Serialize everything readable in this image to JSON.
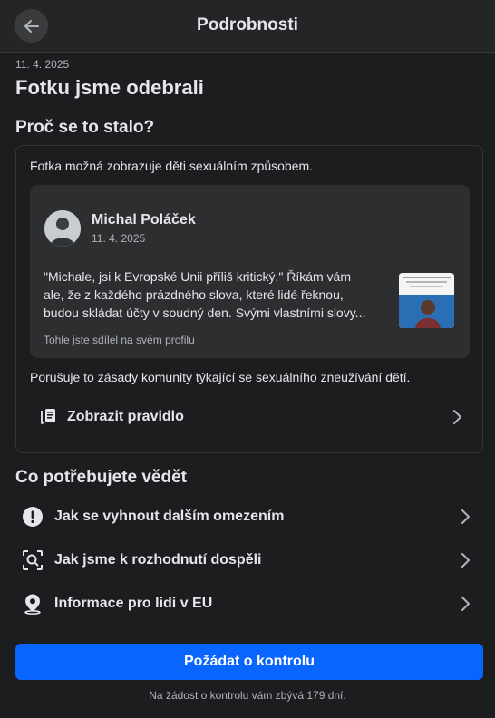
{
  "header": {
    "title": "Podrobnosti",
    "back_icon": "arrow-left-icon"
  },
  "decision": {
    "date": "11. 4. 2025",
    "title": "Fotku jsme odebrali"
  },
  "why": {
    "heading": "Proč se to stalo?",
    "reason": "Fotka možná zobrazuje děti sexuálním způsobem.",
    "post": {
      "author": "Michal Poláček",
      "date": "11. 4. 2025",
      "text_lines": [
        "\"Michale, jsi k Evropské Unii příliš kritický.\" Říkám vám",
        "ale, že z každého prázdného slova, které lidé řeknou,",
        "budou skládat účty v soudný den. Svými vlastními slovy..."
      ],
      "note": "Tohle jste sdílel na svém profilu"
    },
    "violation": "Porušuje to zásady komunity týkající se sexuálního zneužívání dětí.",
    "rule_link": {
      "label": "Zobrazit pravidlo",
      "icon": "rule-book-icon"
    }
  },
  "info": {
    "heading": "Co potřebujete vědět",
    "items": [
      {
        "label": "Jak se vyhnout dalším omezením",
        "icon": "exclamation-circle-icon"
      },
      {
        "label": "Jak jsme k rozhodnutí dospěli",
        "icon": "search-frame-icon"
      },
      {
        "label": "Informace pro lidi v EU",
        "icon": "location-pin-icon"
      }
    ]
  },
  "actions": {
    "review_button": "Požádat o kontrolu",
    "review_note": "Na žádost o kontrolu vám zbývá 179 dní."
  },
  "colors": {
    "primary": "#0866ff",
    "background": "#1c1d1f",
    "card": "#2d2e30"
  }
}
